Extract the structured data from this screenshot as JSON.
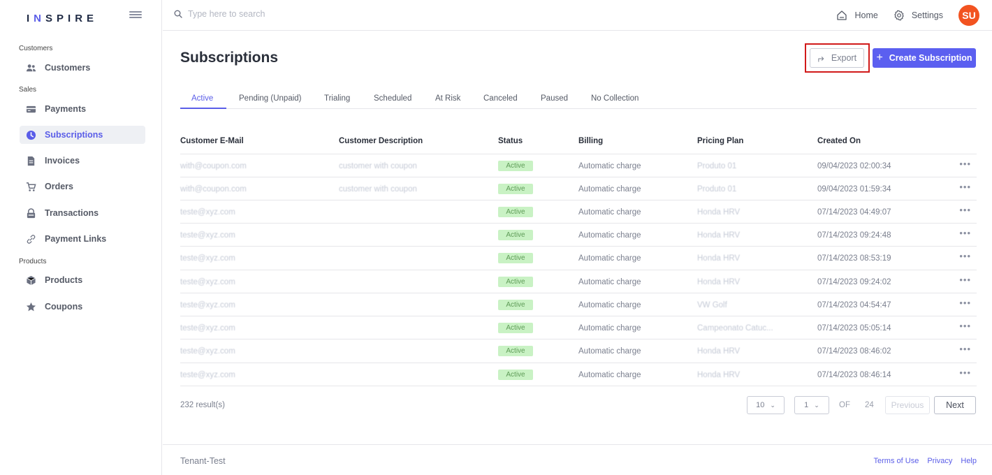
{
  "brand": {
    "name_prefix": "I",
    "name_accent": "N",
    "name_suffix": "SPIRE"
  },
  "search": {
    "placeholder": "Type here to search"
  },
  "topbar": {
    "home": "Home",
    "settings": "Settings",
    "avatar_initials": "SU",
    "avatar_color": "#f25320"
  },
  "sidebar": {
    "sections": {
      "customers": "Customers",
      "sales": "Sales",
      "products": "Products"
    },
    "items": [
      {
        "label": "Customers",
        "icon": "users-icon"
      },
      {
        "label": "Payments",
        "icon": "card-icon"
      },
      {
        "label": "Subscriptions",
        "icon": "clock-icon",
        "active": true
      },
      {
        "label": "Invoices",
        "icon": "document-icon"
      },
      {
        "label": "Orders",
        "icon": "cart-icon"
      },
      {
        "label": "Transactions",
        "icon": "lock-icon"
      },
      {
        "label": "Payment Links",
        "icon": "link-icon"
      },
      {
        "label": "Products",
        "icon": "box-icon"
      },
      {
        "label": "Coupons",
        "icon": "star-icon"
      }
    ]
  },
  "page": {
    "title": "Subscriptions",
    "export_label": "Export",
    "create_label": "Create Subscription",
    "accent_color": "#5b5ff0"
  },
  "tabs": [
    "Active",
    "Pending (Unpaid)",
    "Trialing",
    "Scheduled",
    "At Risk",
    "Canceled",
    "Paused",
    "No Collection"
  ],
  "table": {
    "columns": [
      "Customer E-Mail",
      "Customer Description",
      "Status",
      "Billing",
      "Pricing Plan",
      "Created On"
    ],
    "rows": [
      {
        "email": "with@coupon.com",
        "description": "customer with coupon",
        "status": "Active",
        "billing": "Automatic charge",
        "plan": "Produto 01",
        "created": "09/04/2023 02:00:34"
      },
      {
        "email": "with@coupon.com",
        "description": "customer with coupon",
        "status": "Active",
        "billing": "Automatic charge",
        "plan": "Produto 01",
        "created": "09/04/2023 01:59:34"
      },
      {
        "email": "teste@xyz.com",
        "description": "",
        "status": "Active",
        "billing": "Automatic charge",
        "plan": "Honda HRV",
        "created": "07/14/2023 04:49:07"
      },
      {
        "email": "teste@xyz.com",
        "description": "",
        "status": "Active",
        "billing": "Automatic charge",
        "plan": "Honda HRV",
        "created": "07/14/2023 09:24:48"
      },
      {
        "email": "teste@xyz.com",
        "description": "",
        "status": "Active",
        "billing": "Automatic charge",
        "plan": "Honda HRV",
        "created": "07/14/2023 08:53:19"
      },
      {
        "email": "teste@xyz.com",
        "description": "",
        "status": "Active",
        "billing": "Automatic charge",
        "plan": "Honda HRV",
        "created": "07/14/2023 09:24:02"
      },
      {
        "email": "teste@xyz.com",
        "description": "",
        "status": "Active",
        "billing": "Automatic charge",
        "plan": "VW Golf",
        "created": "07/14/2023 04:54:47"
      },
      {
        "email": "teste@xyz.com",
        "description": "",
        "status": "Active",
        "billing": "Automatic charge",
        "plan": "Campeonato Catuc...",
        "created": "07/14/2023 05:05:14"
      },
      {
        "email": "teste@xyz.com",
        "description": "",
        "status": "Active",
        "billing": "Automatic charge",
        "plan": "Honda HRV",
        "created": "07/14/2023 08:46:02"
      },
      {
        "email": "teste@xyz.com",
        "description": "",
        "status": "Active",
        "billing": "Automatic charge",
        "plan": "Honda HRV",
        "created": "07/14/2023 08:46:14"
      }
    ],
    "row_menu": "•••"
  },
  "pagination": {
    "results": "232 result(s)",
    "page_size": "10",
    "page": "1",
    "of": "OF",
    "total_pages": "24",
    "previous": "Previous",
    "next": "Next"
  },
  "footer": {
    "tenant": "Tenant-Test",
    "links": [
      "Terms of Use",
      "Privacy",
      "Help"
    ]
  }
}
